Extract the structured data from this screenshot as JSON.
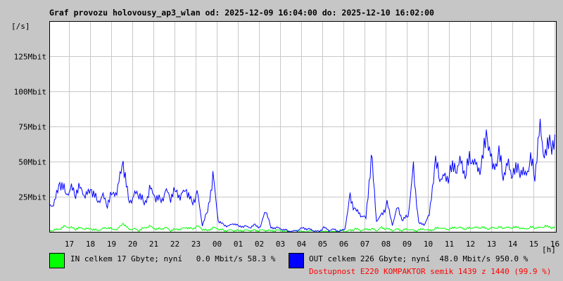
{
  "chart_data": {
    "type": "line",
    "title": "Graf provozu holovousy_ap3_wlan od: 2025-12-09 16:04:00 do: 2025-12-10 16:02:00",
    "ylabel": "[/s]",
    "xlabel": "[h]",
    "ylim": [
      0,
      150
    ],
    "yunit": "Mbit",
    "yticks": [
      {
        "v": 25,
        "label": "25Mbit"
      },
      {
        "v": 50,
        "label": "50Mbit"
      },
      {
        "v": 75,
        "label": "75Mbit"
      },
      {
        "v": 100,
        "label": "100Mbit"
      },
      {
        "v": 125,
        "label": "125Mbit"
      }
    ],
    "xstart_hours": 16.067,
    "xticks": [
      "17",
      "18",
      "19",
      "20",
      "21",
      "22",
      "23",
      "00",
      "01",
      "02",
      "03",
      "04",
      "05",
      "06",
      "07",
      "08",
      "09",
      "10",
      "11",
      "12",
      "13",
      "14",
      "15",
      "16"
    ],
    "grid": true,
    "step_minutes": 15,
    "series": [
      {
        "name": "IN",
        "color": "#00ff00",
        "values": [
          1,
          2,
          4,
          3,
          2,
          3,
          2,
          2,
          1,
          2,
          3,
          2,
          2,
          6,
          2,
          2,
          1,
          3,
          4,
          2,
          2,
          3,
          1,
          2,
          2,
          3,
          2,
          4,
          2,
          1,
          3,
          2,
          1,
          1,
          1,
          1,
          1,
          1,
          1,
          1,
          1,
          1,
          1,
          1,
          0,
          0,
          1,
          0,
          0,
          1,
          0,
          0,
          0,
          0,
          1,
          0,
          1,
          2,
          1,
          2,
          2,
          1,
          3,
          2,
          1,
          2,
          1,
          2,
          1,
          1,
          2,
          1,
          2,
          3,
          2,
          2,
          3,
          3,
          2,
          3,
          3,
          3,
          2,
          3,
          3,
          3,
          3,
          3,
          3,
          2,
          3,
          3,
          3,
          4,
          3,
          3
        ]
      },
      {
        "name": "OUT",
        "color": "#0000ff",
        "values": [
          20,
          35,
          28,
          30,
          28,
          32,
          25,
          30,
          22,
          25,
          20,
          28,
          30,
          50,
          22,
          25,
          28,
          20,
          30,
          25,
          22,
          28,
          25,
          30,
          25,
          30,
          20,
          28,
          5,
          15,
          40,
          8,
          5,
          4,
          6,
          4,
          4,
          3,
          5,
          3,
          16,
          3,
          3,
          2,
          1,
          0,
          1,
          3,
          2,
          1,
          0,
          3,
          1,
          2,
          0,
          2,
          25,
          15,
          12,
          10,
          55,
          8,
          12,
          20,
          5,
          18,
          8,
          12,
          45,
          6,
          5,
          12,
          48,
          40,
          38,
          42,
          45,
          50,
          42,
          55,
          45,
          48,
          70,
          45,
          55,
          42,
          48,
          40,
          45,
          40,
          50,
          42,
          75,
          52,
          65,
          60
        ]
      }
    ]
  },
  "legend": {
    "in_text": "IN celkem 17 Gbyte; nyní   0.0 Mbit/s 58.3 %",
    "out_text": "OUT celkem 226 Gbyte; nyní  48.0 Mbit/s 950.0 %",
    "availability": "Dostupnost E220 KOMPAKTOR semik 1439 z 1440 (99.9 %)",
    "in_color": "#00ff00",
    "out_color": "#0000ff",
    "availability_color": "#ff0000"
  }
}
